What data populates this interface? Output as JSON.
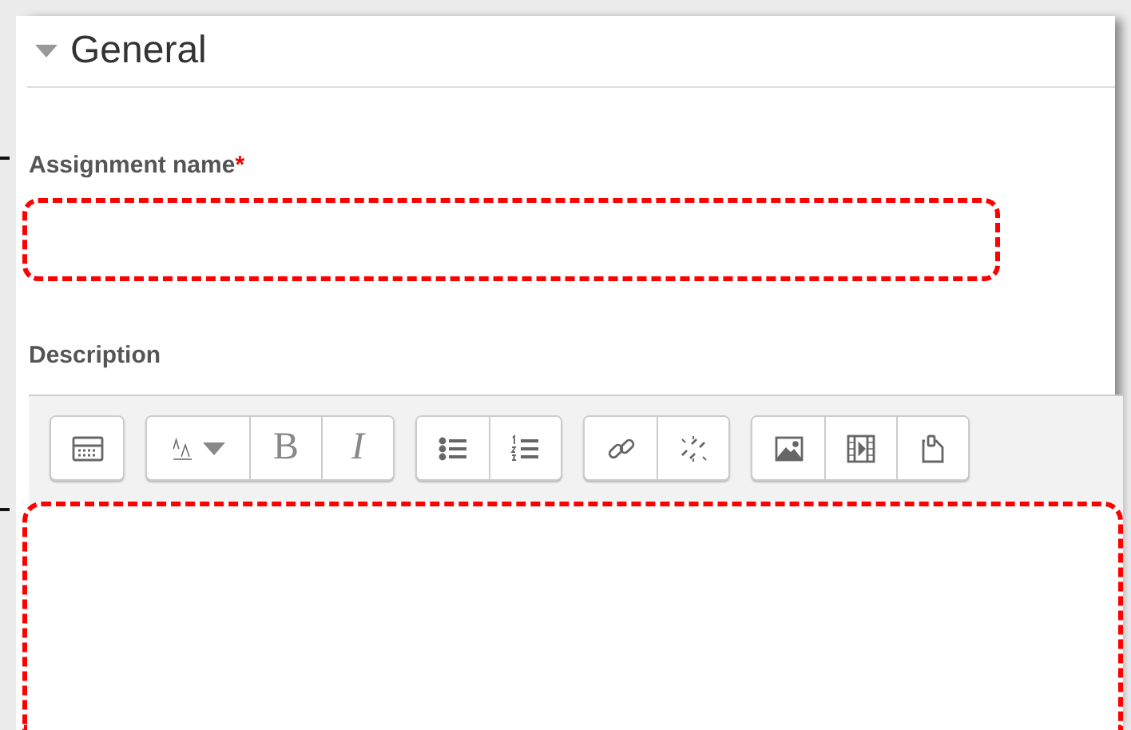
{
  "section": {
    "title": "General",
    "expanded": true
  },
  "fields": [
    {
      "label": "Assignment name",
      "required_mark": "*",
      "kind": "input"
    },
    {
      "label": "Description",
      "kind": "editor"
    }
  ],
  "toolbar": {
    "groups": [
      {
        "buttons": [
          {
            "kind": "icon"
          }
        ]
      },
      {
        "buttons": [
          {
            "kind": "dropdown"
          },
          {
            "kind": "text",
            "label": "B"
          },
          {
            "kind": "text",
            "label": "I"
          }
        ]
      },
      {
        "buttons": [
          {
            "kind": "icon"
          },
          {
            "kind": "icon"
          }
        ]
      },
      {
        "buttons": [
          {
            "kind": "icon"
          },
          {
            "kind": "icon"
          }
        ]
      },
      {
        "buttons": [
          {
            "kind": "icon"
          },
          {
            "kind": "icon"
          },
          {
            "kind": "icon"
          }
        ]
      }
    ]
  }
}
